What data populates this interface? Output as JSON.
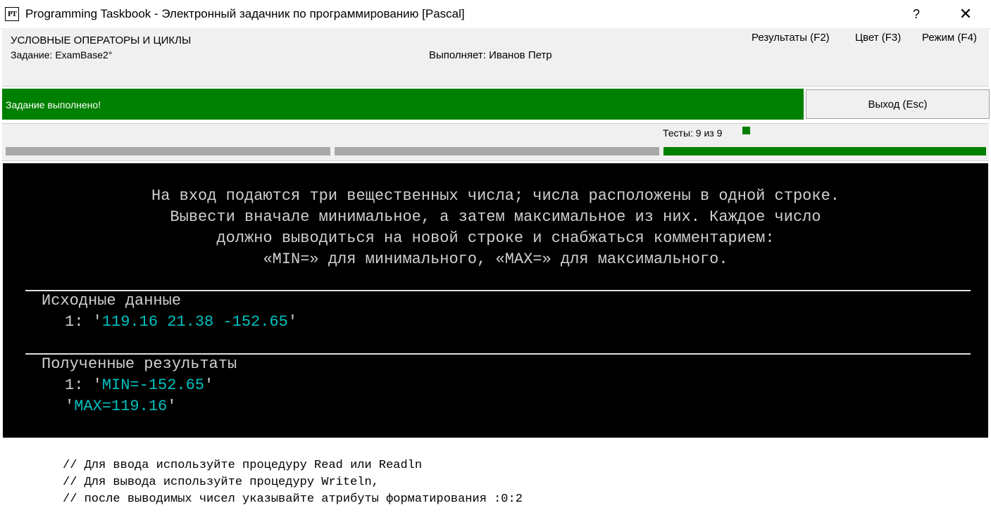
{
  "window": {
    "icon_text": "PT",
    "title": "Programming Taskbook - Электронный задачник по программированию [Pascal]",
    "help_label": "?",
    "close_label": "✕"
  },
  "header": {
    "section_title": "УСЛОВНЫЕ ОПЕРАТОРЫ И ЦИКЛЫ",
    "task": "Задание: ExamBase2°",
    "performer": "Выполняет: Иванов Петр",
    "menu": {
      "results": "Результаты (F2)",
      "color": "Цвет (F3)",
      "mode": "Режим (F4)"
    }
  },
  "status": {
    "message": "Задание выполнено!",
    "exit_label": "Выход (Esc)",
    "color": "#008000"
  },
  "tests": {
    "label": "Тесты:  9 из 9",
    "passed": 9,
    "total": 9
  },
  "console": {
    "description": [
      "На вход подаются три вещественных числа; числа расположены в одной строке.",
      "Вывести вначале минимальное, а затем максимальное из них. Каждое число",
      "должно выводиться на новой строке и снабжаться комментарием:",
      "«MIN=» для минимального, «MAX=» для максимального."
    ],
    "input": {
      "heading": "Исходные данные",
      "line_prefix": "1: '",
      "line_value": "119.16 21.38 -152.65",
      "line_suffix": "'"
    },
    "output": {
      "heading": "Полученные результаты",
      "line1_prefix": "1: '",
      "line1_value": "MIN=-152.65",
      "line1_suffix": "'",
      "line2_prefix": "'",
      "line2_value": "MAX=119.16",
      "line2_suffix": "'"
    }
  },
  "hints": [
    "// Для ввода используйте процедуру Read или Readln",
    "// Для вывода используйте процедуру Writeln,",
    "// после выводимых чисел указывайте атрибуты форматирования :0:2"
  ]
}
